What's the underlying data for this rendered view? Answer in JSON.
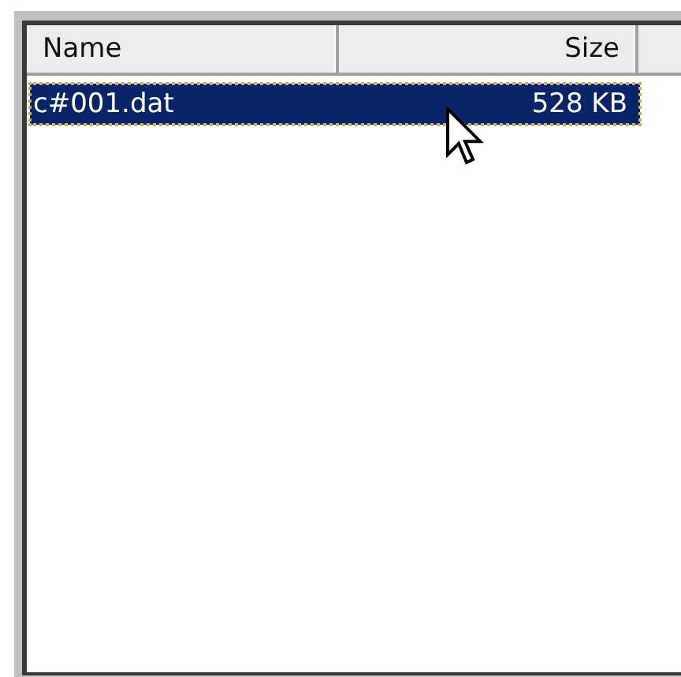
{
  "list": {
    "columns": [
      {
        "label": "Name"
      },
      {
        "label": "Size"
      }
    ],
    "rows": [
      {
        "name": "c#001.dat",
        "size": "528 KB",
        "selected": true
      }
    ]
  }
}
